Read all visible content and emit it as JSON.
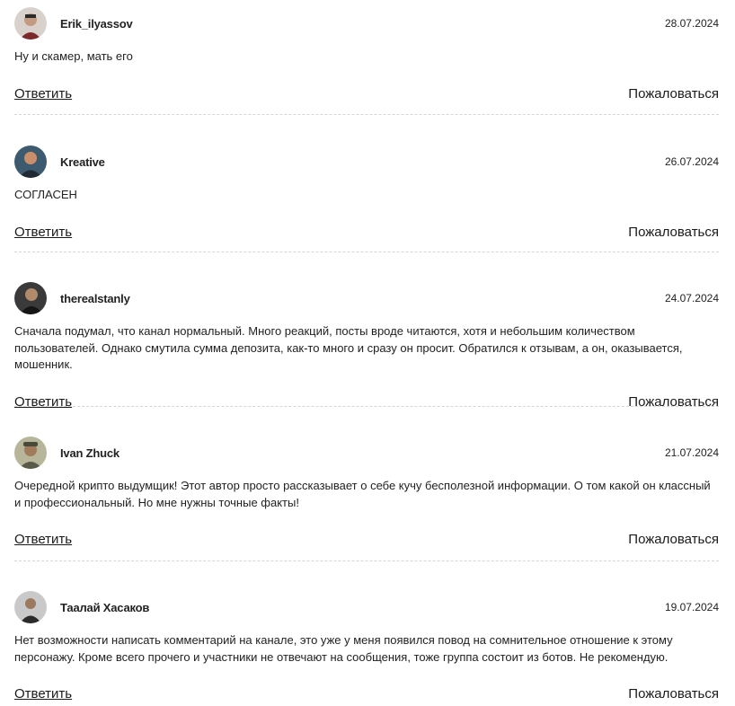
{
  "comments": [
    {
      "author": "Erik_ilyassov",
      "date": "28.07.2024",
      "text": "Ну и скамер, мать его",
      "reply_label": "Ответить",
      "report_label": "Пожаловаться",
      "avatar_bg": "#d9d2cc",
      "avatar_fg": "#7a2a2a"
    },
    {
      "author": "Kreative",
      "date": "26.07.2024",
      "text": "СОГЛАСЕН",
      "reply_label": "Ответить",
      "report_label": "Пожаловаться",
      "avatar_bg": "#3d5a6e",
      "avatar_fg": "#c98f6a"
    },
    {
      "author": "therealstanly",
      "date": "24.07.2024",
      "text": "Сначала подумал, что канал нормальный. Много реакций, посты вроде читаются, хотя и небольшим количеством пользователей. Однако смутила сумма депозита, как-то много и сразу он просит. Обратился к отзывам, а он, оказывается, мошенник.",
      "reply_label": "Ответить",
      "report_label": "Пожаловаться",
      "avatar_bg": "#3a3a3a",
      "avatar_fg": "#b08a6a"
    },
    {
      "author": "Ivan Zhuck",
      "date": "21.07.2024",
      "text": "Очередной крипто выдумщик! Этот автор просто рассказывает о себе кучу бесполезной информации. О том какой он классный и профессиональный. Но мне нужны точные факты!",
      "reply_label": "Ответить",
      "report_label": "Пожаловаться",
      "avatar_bg": "#b7b59a",
      "avatar_fg": "#5a5a48"
    },
    {
      "author": "Таалай Хасаков",
      "date": "19.07.2024",
      "text": "Нет возможности написать комментарий на канале, это уже у меня появился повод на сомнительное отношение к этому персонажу. Кроме всего прочего и участники не отвечают на сообщения, тоже группа состоит из ботов. Не рекомендую.",
      "reply_label": "Ответить",
      "report_label": "Пожаловаться",
      "avatar_bg": "#c9c9c9",
      "avatar_fg": "#2a2a2a"
    }
  ]
}
